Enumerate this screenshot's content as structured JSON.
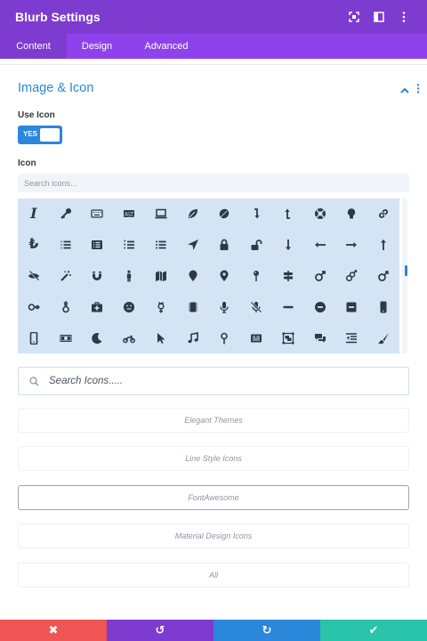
{
  "header": {
    "title": "Blurb Settings",
    "icons": [
      "expand-icon",
      "sidebar-icon",
      "more-vertical-icon"
    ],
    "bg_color": "#7e3bd0"
  },
  "tabs": [
    {
      "label": "Content",
      "active": true
    },
    {
      "label": "Design",
      "active": false
    },
    {
      "label": "Advanced",
      "active": false
    }
  ],
  "section": {
    "title": "Image & Icon",
    "accent_color": "#2b87da"
  },
  "use_icon": {
    "label": "Use Icon",
    "toggle_label": "YES",
    "value": true
  },
  "icon_field": {
    "label": "Icon",
    "search_placeholder": "Search icons..."
  },
  "icon_grid": {
    "rows": [
      [
        "italic",
        "key",
        "keyboard",
        "ab-box",
        "laptop",
        "leaf",
        "leaf-alt",
        "arrow-turn-down",
        "arrow-turn-up",
        "life-ring",
        "lightbulb",
        "link"
      ],
      [
        "lira",
        "list",
        "list-alt",
        "list-ol",
        "list-ul",
        "location-arrow",
        "lock",
        "lock-open",
        "arrow-down-long",
        "arrow-left-long",
        "arrow-right-long",
        "arrow-up-long"
      ],
      [
        "low-vision",
        "magic",
        "magnet",
        "male",
        "map",
        "map-marker",
        "map-marker-alt",
        "map-pin",
        "map-signs",
        "mars",
        "mars-double",
        "mars-stroke"
      ],
      [
        "mars-stroke-h",
        "mars-stroke-v",
        "medkit",
        "meh",
        "mercury",
        "microchip",
        "microphone",
        "microphone-slash",
        "minus",
        "minus-circle",
        "minus-square",
        "mobile"
      ],
      [
        "mobile-alt",
        "money-bill",
        "moon",
        "motorcycle",
        "mouse-pointer",
        "music",
        "neuter",
        "newspaper",
        "object-group",
        "comments",
        "outdent",
        "paint-brush"
      ]
    ]
  },
  "search_icons": {
    "placeholder": "Search Icons....."
  },
  "libraries": [
    {
      "label": "Elegant Themes",
      "selected": false
    },
    {
      "label": "Line Style Icons",
      "selected": false
    },
    {
      "label": "FontAwesome",
      "selected": true
    },
    {
      "label": "Material Design Icons",
      "selected": false
    },
    {
      "label": "All",
      "selected": false
    }
  ],
  "footer": [
    {
      "name": "cancel",
      "icon": "close-icon",
      "glyph": "✖",
      "color": "#ef5555"
    },
    {
      "name": "undo",
      "icon": "undo-icon",
      "glyph": "↺",
      "color": "#7e3bd0"
    },
    {
      "name": "redo",
      "icon": "redo-icon",
      "glyph": "↻",
      "color": "#2b87da"
    },
    {
      "name": "save",
      "icon": "check-icon",
      "glyph": "✔",
      "color": "#29c4a9"
    }
  ]
}
